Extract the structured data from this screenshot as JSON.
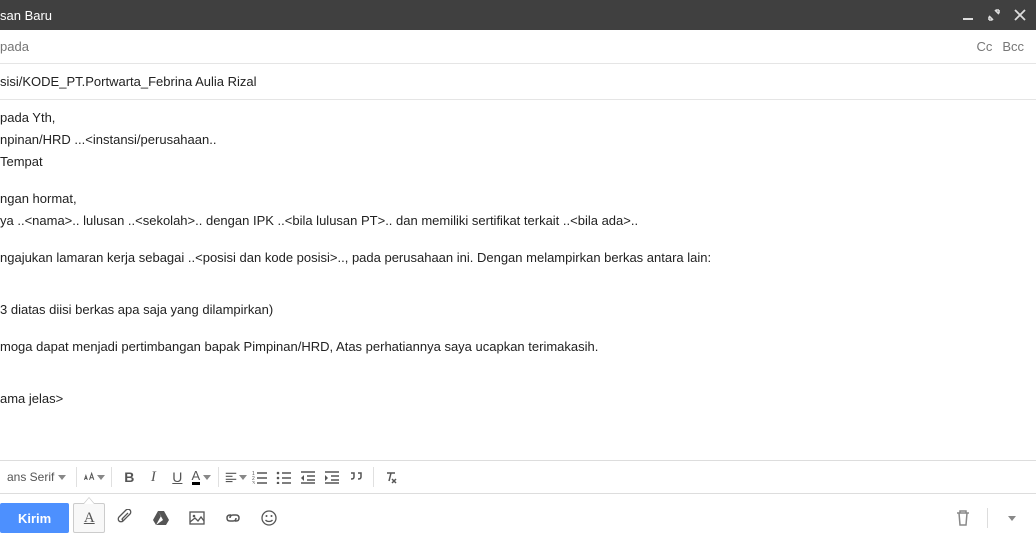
{
  "titlebar": {
    "title": "san Baru"
  },
  "to": {
    "placeholder": "pada",
    "cc": "Cc",
    "bcc": "Bcc"
  },
  "subject": {
    "value": "sisi/KODE_PT.Portwarta_Febrina Aulia Rizal"
  },
  "body": {
    "l1": "pada Yth,",
    "l2": "npinan/HRD ...<instansi/perusahaan..",
    "l3": "Tempat",
    "l4": "ngan hormat,",
    "l5": "ya ..<nama>.. lulusan ..<sekolah>.. dengan IPK ..<bila lulusan PT>.. dan memiliki sertifikat terkait ..<bila ada>..",
    "l6": "ngajukan lamaran kerja sebagai ..<posisi dan kode posisi>.., pada perusahaan ini. Dengan melampirkan berkas antara lain:",
    "l7": "3 diatas diisi berkas apa saja yang dilampirkan)",
    "l8": "moga dapat menjadi pertimbangan bapak Pimpinan/HRD, Atas perhatiannya saya ucapkan terimakasih.",
    "l9": "ama jelas>"
  },
  "format": {
    "font_label": "ans Serif"
  },
  "bottom": {
    "send": "Kirim"
  }
}
